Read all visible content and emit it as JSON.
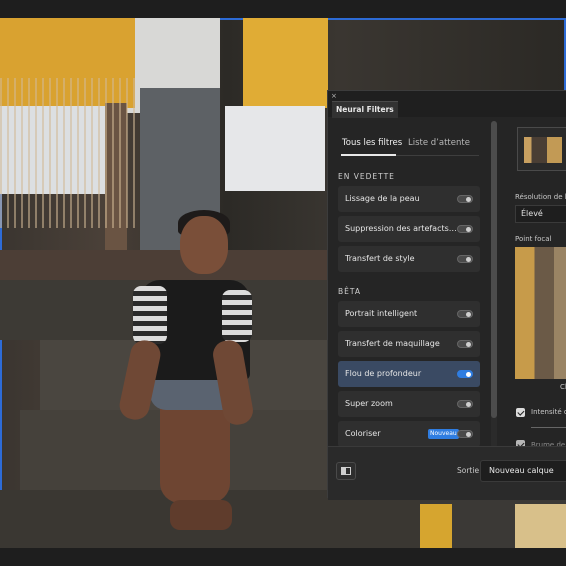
{
  "panel": {
    "close_glyph": "×",
    "title": "Neural Filters",
    "tabs": [
      {
        "label": "Tous les filtres",
        "active": true
      },
      {
        "label": "Liste d’attente",
        "active": false
      }
    ],
    "sections": [
      {
        "title": "EN VEDETTE",
        "items": [
          {
            "label": "Lissage de la peau",
            "enabled": false
          },
          {
            "label": "Suppression des artefacts…",
            "enabled": false
          },
          {
            "label": "Transfert de style",
            "enabled": false
          }
        ]
      },
      {
        "title": "BÊTA",
        "items": [
          {
            "label": "Portrait intelligent",
            "enabled": false
          },
          {
            "label": "Transfert de maquillage",
            "enabled": false
          },
          {
            "label": "Flou de profondeur",
            "enabled": true,
            "selected": true
          },
          {
            "label": "Super zoom",
            "enabled": false
          },
          {
            "label": "Coloriser",
            "enabled": false,
            "badge": "Nouveau"
          }
        ]
      }
    ],
    "settings": {
      "resolution_label": "Résolution de la c",
      "resolution_value": "Élevé",
      "focal_label": "Point focal",
      "focal_caption": "Cl",
      "intensity_label": "Intensité du",
      "haze_label": "Brume de fo"
    },
    "footer": {
      "output_label": "Sortie",
      "output_value": "Nouveau calque"
    },
    "accent_color": "#2f7de1"
  }
}
